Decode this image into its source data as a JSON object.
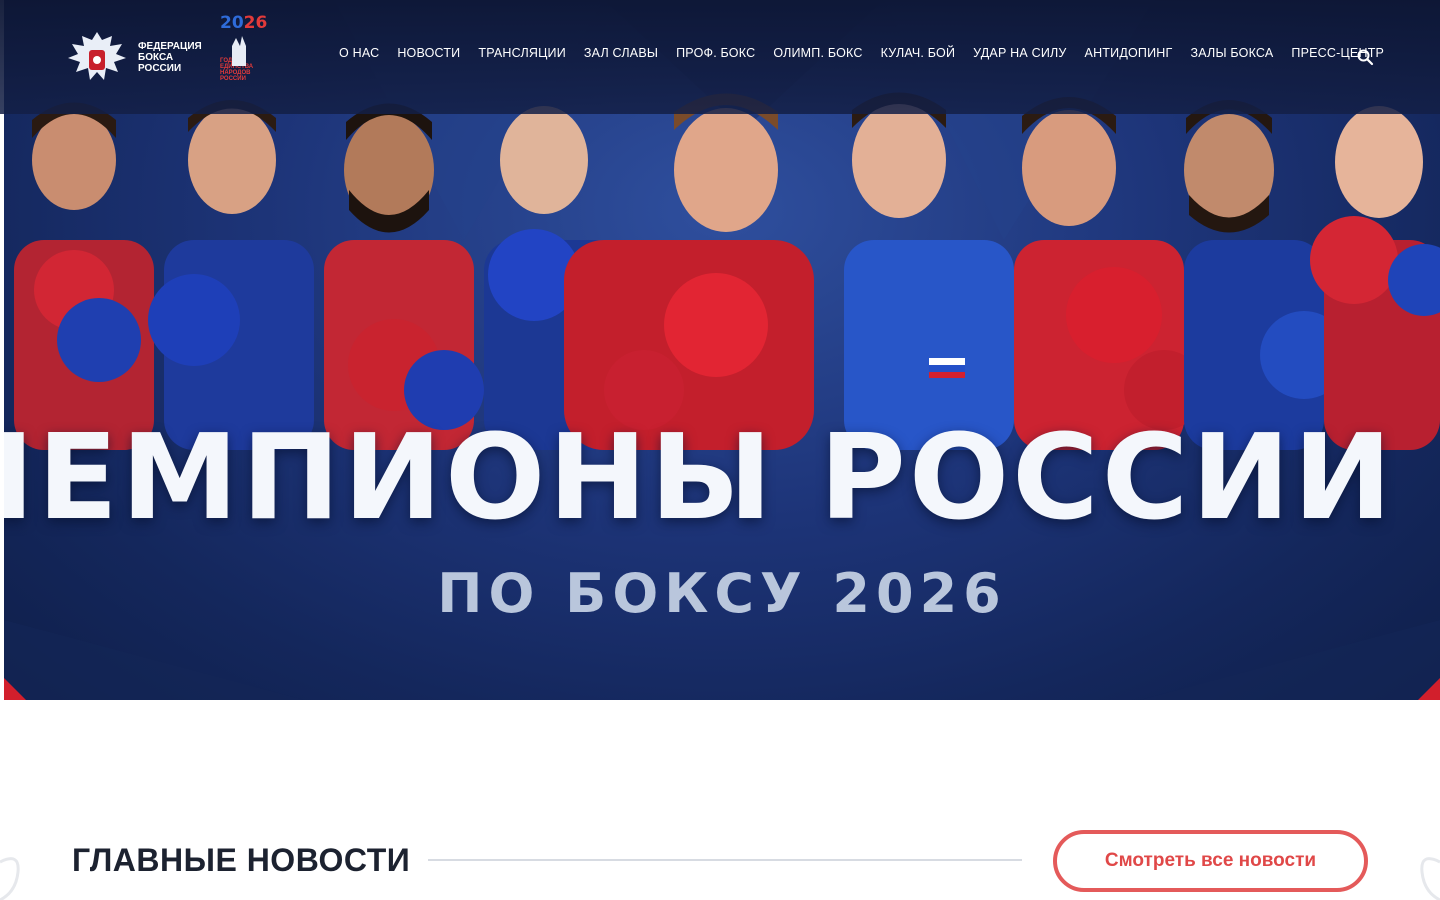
{
  "header": {
    "logo_text": "ФЕДЕРАЦИЯ БОКСА РОССИИ",
    "year_logo": {
      "year_a": "20",
      "year_b": "26",
      "caption": "ГОД ЕДИНСТВА НАРОДОВ РОССИИ"
    },
    "nav": [
      "О НАС",
      "НОВОСТИ",
      "ТРАНСЛЯЦИИ",
      "ЗАЛ СЛАВЫ",
      "ПРОФ. БОКС",
      "ОЛИМП. БОКС",
      "КУЛАЧ. БОЙ",
      "УДАР НА СИЛУ",
      "АНТИДОПИНГ",
      "ЗАЛЫ БОКСА",
      "ПРЕСС-ЦЕНТР"
    ],
    "search_icon": "search-icon"
  },
  "hero": {
    "title": "ЧЕМПИОНЫ РОССИИ",
    "subtitle": "ПО БОКСУ 2026"
  },
  "news": {
    "title": "ГЛАВНЫЕ НОВОСТИ",
    "all_button": "Смотреть все новости"
  },
  "colors": {
    "accent_red": "#e04848",
    "hero_blue": "#1d3478",
    "header_dark": "#0d1634"
  }
}
